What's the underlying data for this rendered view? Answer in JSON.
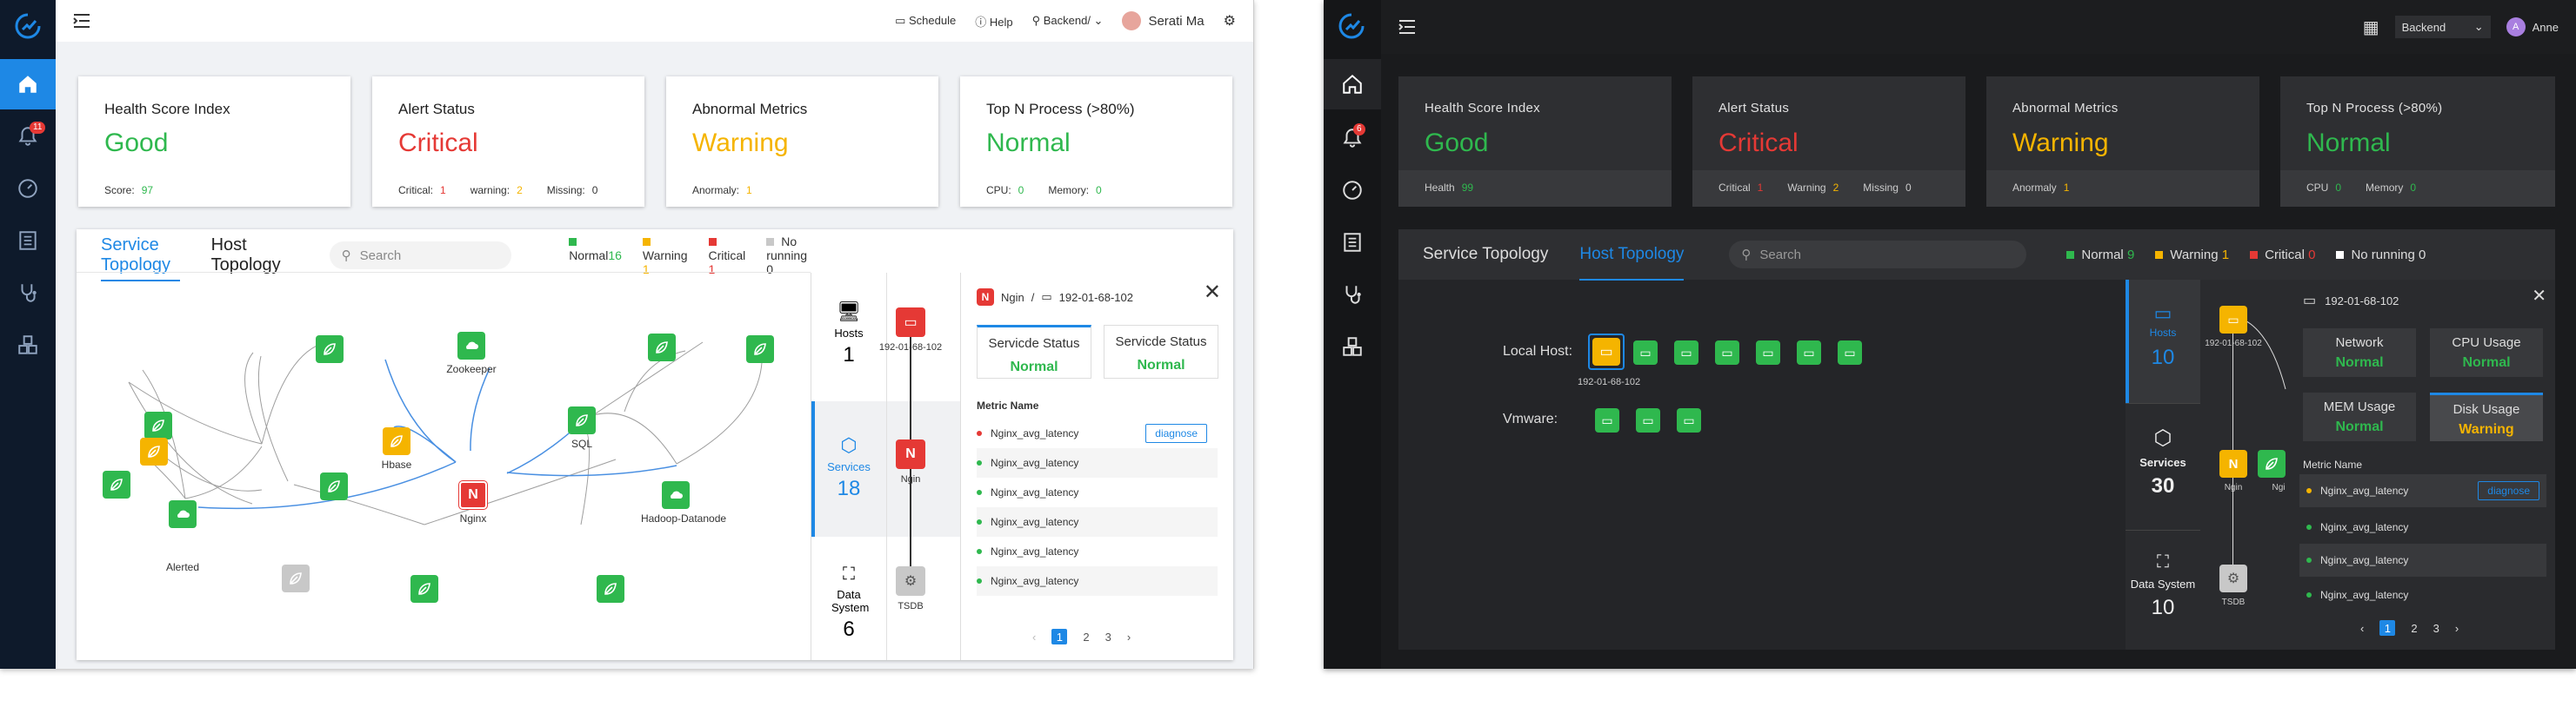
{
  "light": {
    "topbar": {
      "schedule": "Schedule",
      "help": "Help",
      "backend": "Backend/",
      "user": "Serati Ma"
    },
    "sidebar": {
      "alert_badge": "11"
    },
    "cards": [
      {
        "title": "Health Score Index",
        "value": "Good",
        "color": "#2fb84e",
        "subs": [
          {
            "label": "Score:",
            "value": "97",
            "color": "#2fb84e"
          }
        ]
      },
      {
        "title": "Alert Status",
        "value": "Critical",
        "color": "#e53935",
        "subs": [
          {
            "label": "Critical:",
            "value": "1",
            "color": "#e53935"
          },
          {
            "label": "warning:",
            "value": "2",
            "color": "#f5b400"
          },
          {
            "label": "Missing:",
            "value": "0",
            "color": "#333"
          }
        ]
      },
      {
        "title": "Abnormal Metrics",
        "value": "Warning",
        "color": "#f5b400",
        "subs": [
          {
            "label": "Anormaly:",
            "value": "1",
            "color": "#f5b400"
          }
        ]
      },
      {
        "title": "Top N Process (>80%)",
        "value": "Normal",
        "color": "#2fb84e",
        "subs": [
          {
            "label": "CPU:",
            "value": "0",
            "color": "#2fb84e"
          },
          {
            "label": "Memory:",
            "value": "0",
            "color": "#2fb84e"
          }
        ]
      }
    ],
    "tabs": [
      "Service Topology",
      "Host Topology"
    ],
    "search_placeholder": "Search",
    "legend": [
      {
        "label": "Normal",
        "count": "16",
        "color": "#2fb84e"
      },
      {
        "label": "Warning",
        "count": "1",
        "color": "#f5b400"
      },
      {
        "label": "Critical",
        "count": "1",
        "color": "#e53935"
      },
      {
        "label": "No running",
        "count": "0",
        "color": "#c8c8c8"
      }
    ],
    "node_labels": {
      "zookeeper": "Zookeeper",
      "hbase": "Hbase",
      "sql": "SQL",
      "nginx": "Nginx",
      "hadoop": "Hadoop-Datanode",
      "alerted": "Alerted"
    },
    "columns": [
      {
        "title": "Hosts",
        "count": "1",
        "node_label": "192-01-68-102"
      },
      {
        "title": "Services",
        "count": "18",
        "node_label": "Ngin"
      },
      {
        "title": "Data System",
        "count": "6",
        "node_label": "TSDB"
      }
    ],
    "detail": {
      "service": "Ngin",
      "sep": "/",
      "host": "192-01-68-102",
      "status": [
        {
          "title": "Servicde Status",
          "value": "Normal"
        },
        {
          "title": "Servicde Status",
          "value": "Normal"
        }
      ],
      "metric_header": "Metric Name",
      "metrics": [
        "Nginx_avg_latency",
        "Nginx_avg_latency",
        "Nginx_avg_latency",
        "Nginx_avg_latency",
        "Nginx_avg_latency",
        "Nginx_avg_latency"
      ],
      "diagnose": "diagnose",
      "pages": [
        "1",
        "2",
        "3"
      ]
    }
  },
  "dark": {
    "topbar": {
      "backend": "Backend",
      "user": "Anne"
    },
    "sidebar": {
      "alert_badge": "6"
    },
    "cards": [
      {
        "title": "Health Score Index",
        "value": "Good",
        "color": "#2fb84e",
        "subs": [
          {
            "label": "Health",
            "value": "99",
            "color": "#2fb84e"
          }
        ]
      },
      {
        "title": "Alert Status",
        "value": "Critical",
        "color": "#e53935",
        "subs": [
          {
            "label": "Critical",
            "value": "1",
            "color": "#e53935"
          },
          {
            "label": "Warning",
            "value": "2",
            "color": "#f5b400"
          },
          {
            "label": "Missing",
            "value": "0",
            "color": "#ddd"
          }
        ]
      },
      {
        "title": "Abnormal Metrics",
        "value": "Warning",
        "color": "#f5b400",
        "subs": [
          {
            "label": "Anormaly",
            "value": "1",
            "color": "#f5b400"
          }
        ]
      },
      {
        "title": "Top N Process (>80%)",
        "value": "Normal",
        "color": "#2fb84e",
        "subs": [
          {
            "label": "CPU",
            "value": "0",
            "color": "#2fb84e"
          },
          {
            "label": "Memory",
            "value": "0",
            "color": "#2fb84e"
          }
        ]
      }
    ],
    "tabs": [
      "Service Topology",
      "Host Topology"
    ],
    "search_placeholder": "Search",
    "legend": [
      {
        "label": "Normal",
        "count": "9",
        "color": "#2fb84e"
      },
      {
        "label": "Warning",
        "count": "1",
        "color": "#f5b400"
      },
      {
        "label": "Critical",
        "count": "0",
        "color": "#e53935"
      },
      {
        "label": "No running",
        "count": "0",
        "color": "#ffffff"
      }
    ],
    "host_rows": [
      {
        "label": "Local Host:",
        "sub": "192-01-68-102"
      },
      {
        "label": "Vmware:"
      }
    ],
    "columns": [
      {
        "title": "Hosts",
        "count": "10",
        "node_label": "192-01-68-102"
      },
      {
        "title": "Services",
        "count": "30",
        "node_label": "Ngin",
        "extra_label": "Ngi"
      },
      {
        "title": "Data System",
        "count": "10",
        "node_label": "TSDB"
      }
    ],
    "detail": {
      "host": "192-01-68-102",
      "status": [
        {
          "title": "Network",
          "value": "Normal",
          "color": "#2fb84e"
        },
        {
          "title": "CPU Usage",
          "value": "Normal",
          "color": "#2fb84e"
        },
        {
          "title": "MEM Usage",
          "value": "Normal",
          "color": "#2fb84e"
        },
        {
          "title": "Disk Usage",
          "value": "Warning",
          "color": "#f5b400"
        }
      ],
      "metric_header": "Metric Name",
      "metrics": [
        "Nginx_avg_latency",
        "Nginx_avg_latency",
        "Nginx_avg_latency",
        "Nginx_avg_latency"
      ],
      "diagnose": "diagnose",
      "pages": [
        "1",
        "2",
        "3"
      ]
    }
  }
}
